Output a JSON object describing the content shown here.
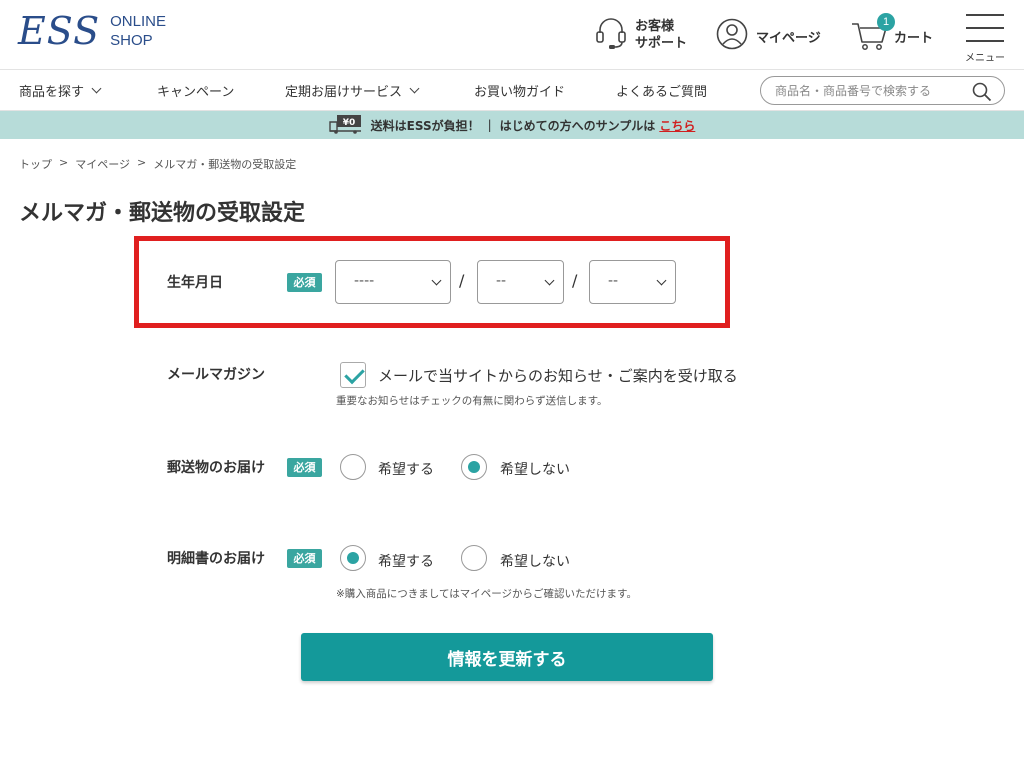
{
  "header": {
    "logo_mark": "ESS",
    "logo_line1": "ONLINE",
    "logo_line2": "SHOP",
    "support_line1": "お客様",
    "support_line2": "サポート",
    "mypage": "マイページ",
    "cart": "カート",
    "cart_count": "1",
    "menu": "メニュー"
  },
  "nav": {
    "items": [
      {
        "label": "商品を探す",
        "has_dropdown": true
      },
      {
        "label": "キャンペーン",
        "has_dropdown": false
      },
      {
        "label": "定期お届けサービス",
        "has_dropdown": true
      },
      {
        "label": "お買い物ガイド",
        "has_dropdown": false
      },
      {
        "label": "よくあるご質問",
        "has_dropdown": false
      }
    ],
    "search_placeholder": "商品名・商品番号で検索する"
  },
  "banner": {
    "price_tag": "¥0",
    "text1": "送料はESSが負担！",
    "separator": "|",
    "text2": "はじめての方へのサンプルは",
    "link": "こちら",
    "link_color": "#d02020"
  },
  "breadcrumb": [
    "トップ",
    "マイページ",
    "メルマガ・郵送物の受取設定"
  ],
  "breadcrumb_sep": ">",
  "page_title": "メルマガ・郵送物の受取設定",
  "form": {
    "required_label": "必須",
    "birthday": {
      "label": "生年月日",
      "year_value": "----",
      "month_value": "--",
      "day_value": "--",
      "separator": "/"
    },
    "newsletter": {
      "label": "メールマガジン",
      "checkbox_label": "メールで当サイトからのお知らせ・ご案内を受け取る",
      "checked": true,
      "note": "重要なお知らせはチェックの有無に関わらず送信します。"
    },
    "postal": {
      "label": "郵送物のお届け",
      "option_yes": "希望する",
      "option_no": "希望しない",
      "selected": "no"
    },
    "statement": {
      "label": "明細書のお届け",
      "option_yes": "希望する",
      "option_no": "希望しない",
      "selected": "yes",
      "note": "※購入商品につきましてはマイページからご確認いただけます。"
    },
    "submit_label": "情報を更新する"
  },
  "colors": {
    "accent": "#14999a",
    "banner_bg": "#b7dcd9",
    "highlight": "#e01f1f",
    "brand": "#2a4d8a"
  }
}
